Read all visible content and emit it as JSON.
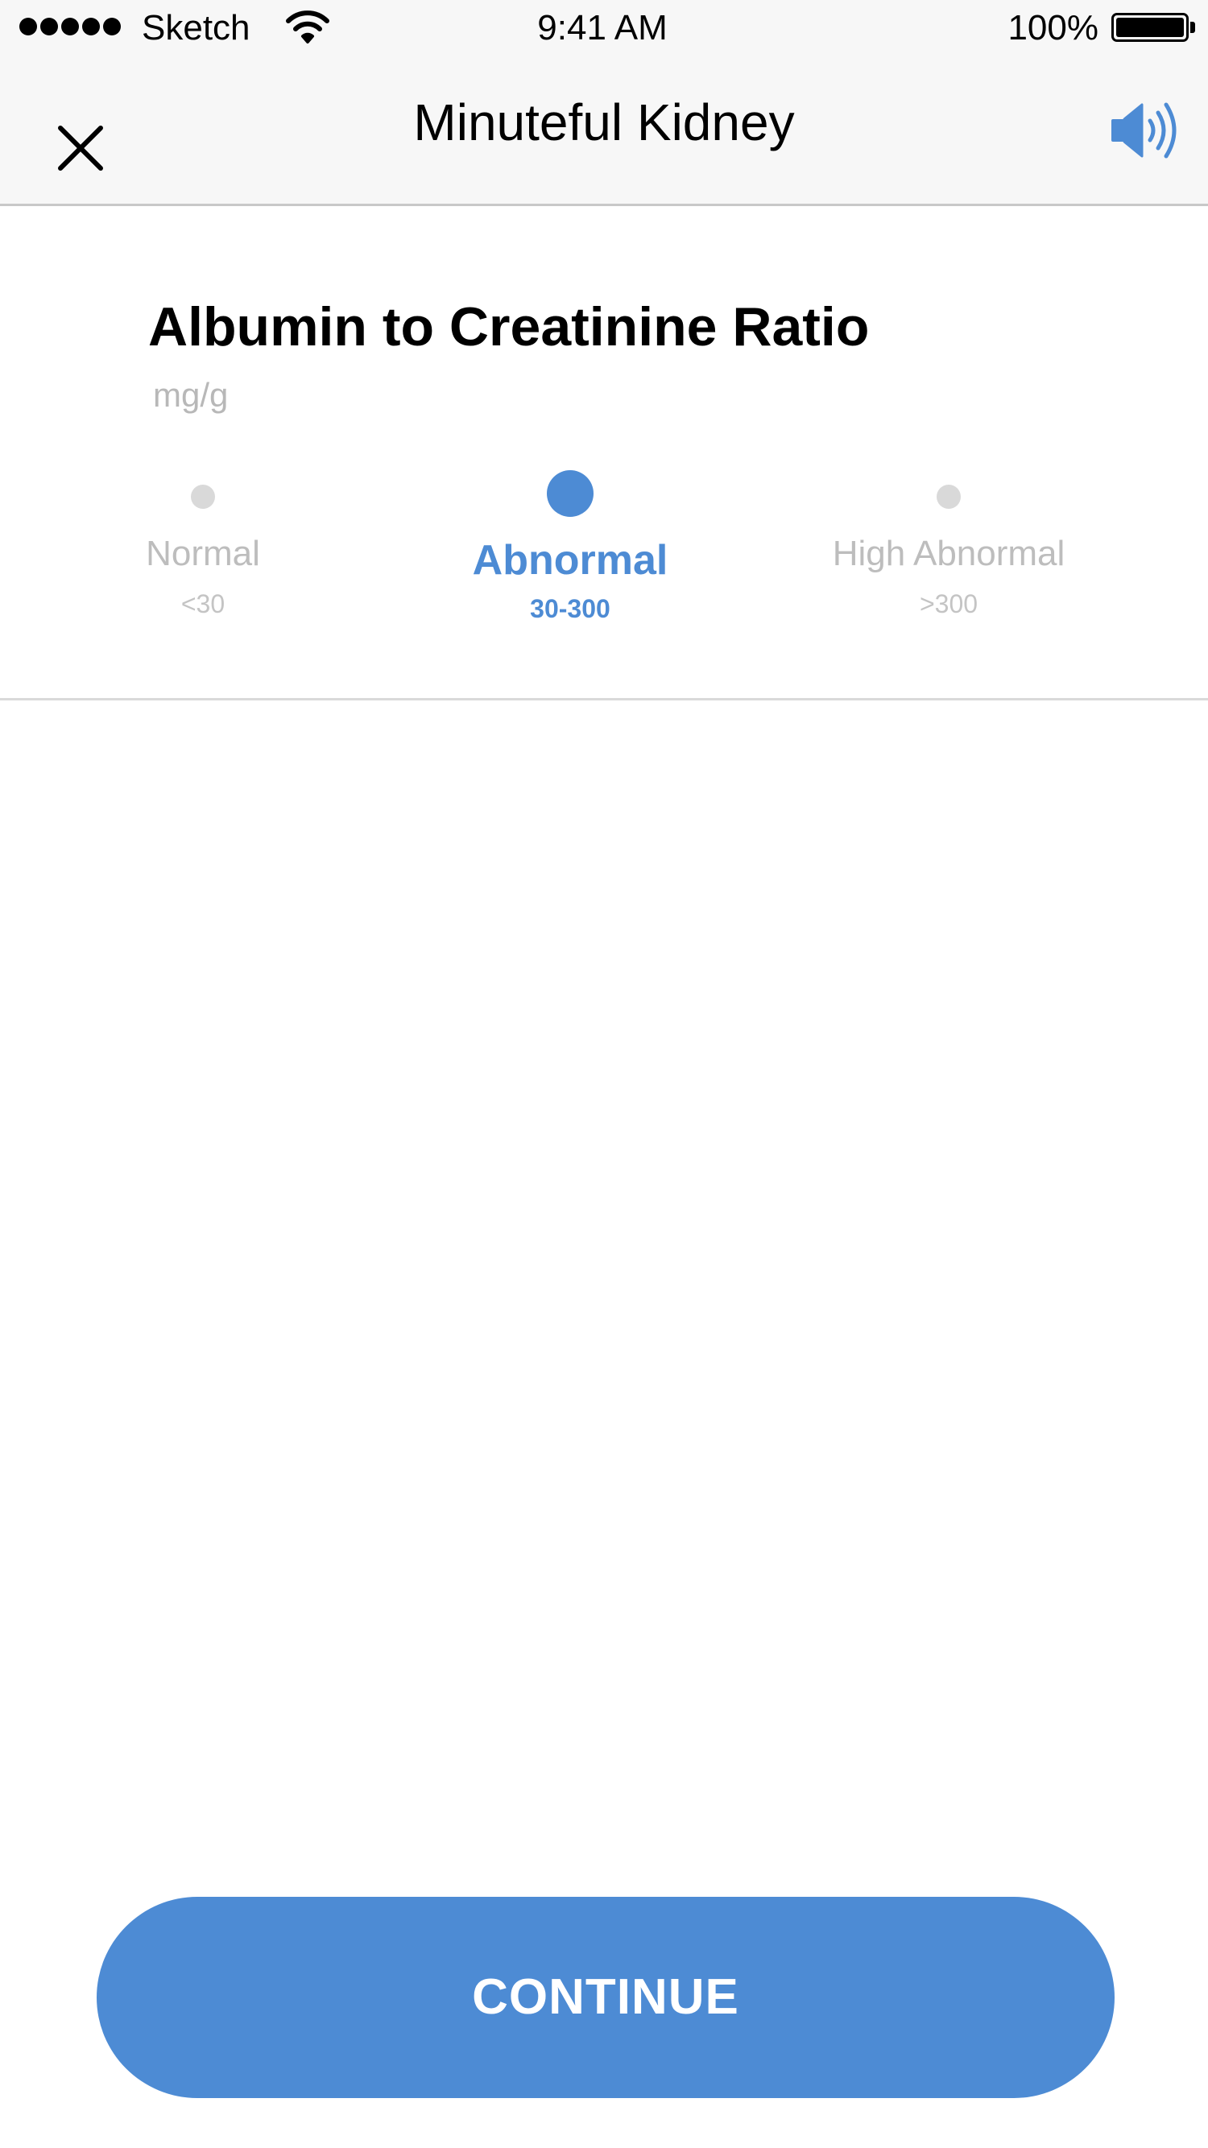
{
  "status_bar": {
    "carrier": "Sketch",
    "time": "9:41 AM",
    "battery_percent": "100%",
    "battery_level": 1.0,
    "signal_bars": 5
  },
  "nav": {
    "title": "Minuteful Kidney",
    "close_icon": "close-icon",
    "sound_icon": "speaker-icon"
  },
  "measurement": {
    "title": "Albumin to Creatinine Ratio",
    "unit": "mg/g",
    "options": [
      {
        "label": "Normal",
        "range": "<30",
        "selected": false
      },
      {
        "label": "Abnormal",
        "range": "30-300",
        "selected": true
      },
      {
        "label": "High Abnormal",
        "range": ">300",
        "selected": false
      }
    ]
  },
  "actions": {
    "continue_label": "CONTINUE"
  },
  "colors": {
    "accent": "#4d8bd4",
    "inactive_text": "#bdbdbd",
    "inactive_dot": "#d9d9d9",
    "bar_background": "#f7f7f7"
  }
}
